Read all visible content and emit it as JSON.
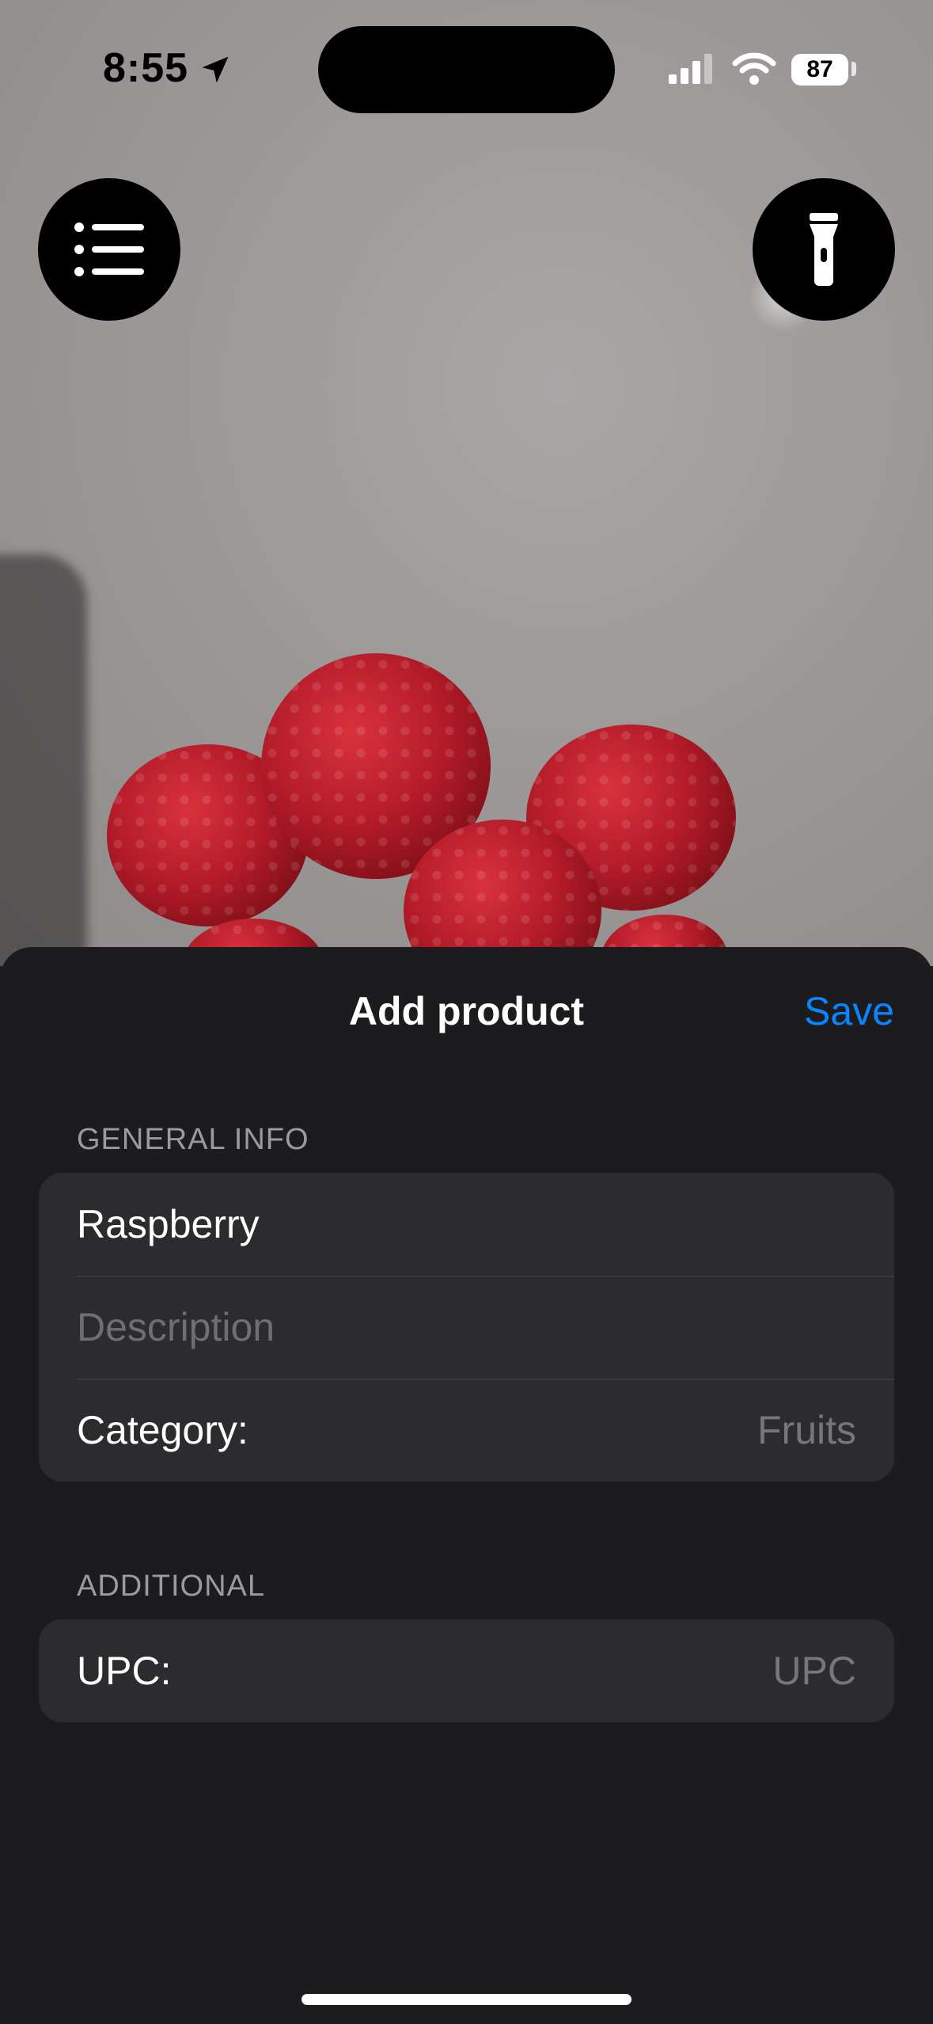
{
  "status_bar": {
    "time": "8:55",
    "battery": "87"
  },
  "top_buttons": {
    "menu_icon": "list-icon",
    "flash_icon": "flashlight-icon"
  },
  "sheet": {
    "title": "Add product",
    "save_label": "Save",
    "general_info": {
      "header": "GENERAL INFO",
      "name_value": "Raspberry",
      "description_placeholder": "Description",
      "category_label": "Category:",
      "category_value": "Fruits"
    },
    "additional": {
      "header": "ADDITIONAL",
      "upc_label": "UPC:",
      "upc_placeholder": "UPC"
    }
  },
  "colors": {
    "accent": "#0a84ff",
    "sheet_bg": "#1c1c1e",
    "group_bg": "#2c2c2e"
  }
}
